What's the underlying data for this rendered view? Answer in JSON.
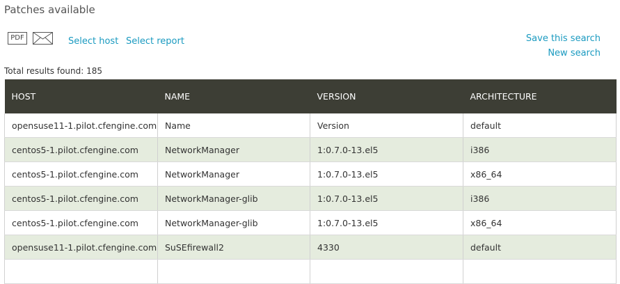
{
  "page": {
    "title": "Patches available",
    "total_results": "Total results found: 185"
  },
  "toolbar": {
    "pdf_label": "PDF",
    "select_host": "Select host",
    "select_report": "Select report",
    "save_search": "Save this search",
    "new_search": "New search",
    "icons": [
      "pdf-icon",
      "mail-icon"
    ]
  },
  "table": {
    "columns": [
      "HOST",
      "NAME",
      "VERSION",
      "ARCHITECTURE"
    ],
    "rows": [
      [
        "opensuse11-1.pilot.cfengine.com",
        "Name",
        "Version",
        "default"
      ],
      [
        "centos5-1.pilot.cfengine.com",
        "NetworkManager",
        "1:0.7.0-13.el5",
        "i386"
      ],
      [
        "centos5-1.pilot.cfengine.com",
        "NetworkManager",
        "1:0.7.0-13.el5",
        "x86_64"
      ],
      [
        "centos5-1.pilot.cfengine.com",
        "NetworkManager-glib",
        "1:0.7.0-13.el5",
        "i386"
      ],
      [
        "centos5-1.pilot.cfengine.com",
        "NetworkManager-glib",
        "1:0.7.0-13.el5",
        "x86_64"
      ],
      [
        "opensuse11-1.pilot.cfengine.com",
        "SuSEfirewall2",
        "4330",
        "default"
      ],
      [
        "",
        "",
        "",
        ""
      ]
    ]
  },
  "colors": {
    "header_bg": "#3d3e35",
    "stripe_bg": "#e5ecde",
    "link": "#1a9ac0"
  }
}
